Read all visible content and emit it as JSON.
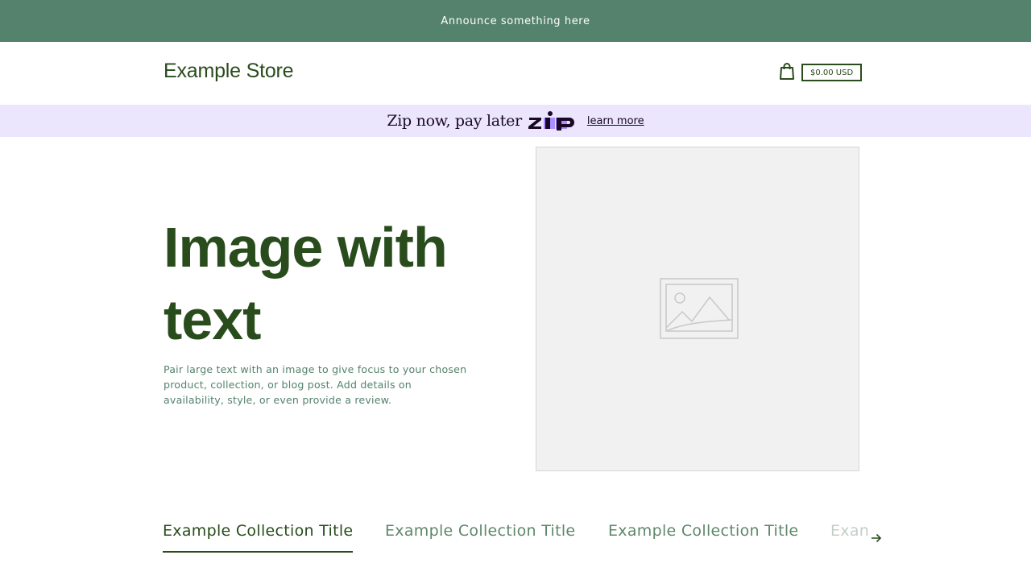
{
  "announcement": {
    "text": "Announce something here"
  },
  "header": {
    "logo": "Example Store",
    "cart_icon": "shopping-bag-icon",
    "cart_total": "$0.00 USD"
  },
  "zip_banner": {
    "text": "Zip now, pay later",
    "logo_name": "zip-logo",
    "link": "learn more",
    "colors": {
      "background": "#ebe6fd",
      "logo_purple": "#aa8fff",
      "ink": "#1a0826"
    }
  },
  "hero": {
    "title": "Image with text",
    "description": "Pair large text with an image to give focus to your chosen product, collection, or blog post. Add details on availability, style, or even provide a review.",
    "image_icon": "image-placeholder-icon"
  },
  "collection_tabs": {
    "items": [
      {
        "label": "Example Collection Title",
        "active": true
      },
      {
        "label": "Example Collection Title",
        "active": false
      },
      {
        "label": "Example Collection Title",
        "active": false
      },
      {
        "label": "Exan",
        "active": false
      }
    ],
    "next_icon": "arrow-right-icon"
  },
  "colors": {
    "announcement_bg": "#54826c",
    "primary_text": "#294c1c",
    "secondary_text": "#54826c",
    "placeholder_bg": "#f1f1f1"
  }
}
